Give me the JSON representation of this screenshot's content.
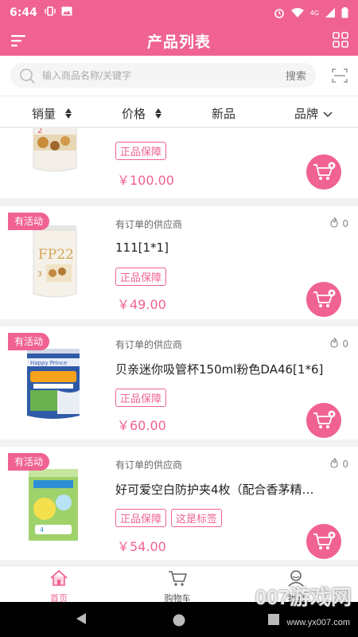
{
  "status": {
    "time": "6:44",
    "network": "4G"
  },
  "header": {
    "title": "产品列表"
  },
  "search": {
    "placeholder": "输入商品名称/关键字",
    "button": "搜索"
  },
  "sort": {
    "sales": "销量",
    "price": "价格",
    "new": "新品",
    "brand": "品牌"
  },
  "products": [
    {
      "tag": "",
      "supplier": "",
      "name": "",
      "badges": [
        "正品保障"
      ],
      "price": "￥100.00",
      "hot": ""
    },
    {
      "tag": "有活动",
      "supplier": "有订单的供应商",
      "name": "111[1*1]",
      "badges": [
        "正品保障"
      ],
      "price": "￥49.00",
      "hot": "0"
    },
    {
      "tag": "有活动",
      "supplier": "有订单的供应商",
      "name": "贝亲迷你吸管杯150ml粉色DA46[1*6]",
      "badges": [
        "正品保障"
      ],
      "price": "￥60.00",
      "hot": "0"
    },
    {
      "tag": "有活动",
      "supplier": "有订单的供应商",
      "name": "好可爱空白防护夹4枚（配合香茅精…",
      "badges": [
        "正品保障",
        "这是标签"
      ],
      "price": "￥54.00",
      "hot": "0"
    }
  ],
  "tabs": {
    "home": "首页",
    "cart": "购物车",
    "mine": "我的"
  },
  "watermark": {
    "brand": "007游戏网",
    "url": "www.yx007.com"
  },
  "colors": {
    "accent": "#f06292"
  }
}
